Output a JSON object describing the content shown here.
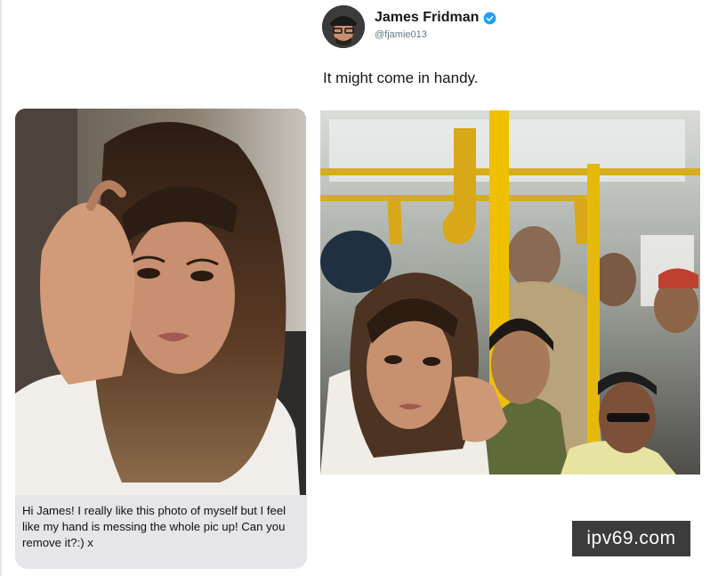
{
  "tweet": {
    "author_name": "James Fridman",
    "author_handle": "@fjamie013",
    "text": "It might come in handy.",
    "verified_color": "#1da1f2"
  },
  "left_image": {
    "description_icon": "selfie-photo"
  },
  "message": {
    "text": "Hi James! I really like this photo of myself but I feel like my hand is messing the whole pic up! Can you remove it?:) x",
    "bubble_color": "#e5e5ea"
  },
  "right_image": {
    "description_icon": "bus-photo",
    "pole_color": "#f2c200"
  },
  "watermark": {
    "text": "ipv69.com"
  }
}
